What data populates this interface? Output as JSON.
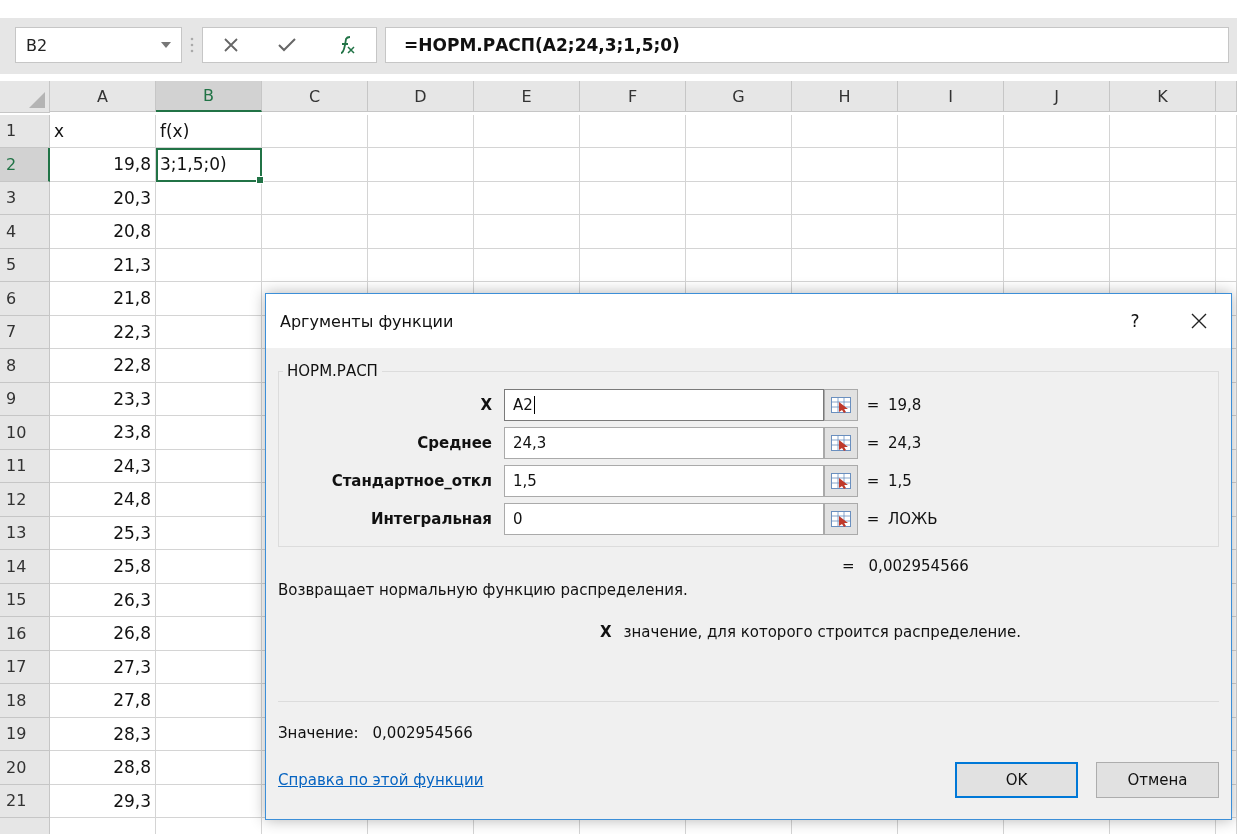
{
  "name_box": {
    "value": "B2"
  },
  "formula_bar": {
    "value": "=НОРМ.РАСП(A2;24,3;1,5;0)"
  },
  "columns": [
    {
      "label": "A",
      "selected": false
    },
    {
      "label": "B",
      "selected": true
    },
    {
      "label": "C",
      "selected": false
    },
    {
      "label": "D",
      "selected": false
    },
    {
      "label": "E",
      "selected": false
    },
    {
      "label": "F",
      "selected": false
    },
    {
      "label": "G",
      "selected": false
    },
    {
      "label": "H",
      "selected": false
    },
    {
      "label": "I",
      "selected": false
    },
    {
      "label": "J",
      "selected": false
    },
    {
      "label": "K",
      "selected": false
    }
  ],
  "rows": [
    {
      "label": "1",
      "selected": false,
      "cells": [
        {
          "text": "x",
          "kind": "text",
          "selected": false
        },
        {
          "text": "f(x)",
          "kind": "text",
          "selected": false
        }
      ]
    },
    {
      "label": "2",
      "selected": true,
      "cells": [
        {
          "text": "19,8",
          "kind": "number",
          "selected": false
        },
        {
          "text": "3;1,5;0)",
          "kind": "text",
          "selected": true
        }
      ]
    },
    {
      "label": "3",
      "selected": false,
      "cells": [
        {
          "text": "20,3",
          "kind": "number",
          "selected": false
        }
      ]
    },
    {
      "label": "4",
      "selected": false,
      "cells": [
        {
          "text": "20,8",
          "kind": "number",
          "selected": false
        }
      ]
    },
    {
      "label": "5",
      "selected": false,
      "cells": [
        {
          "text": "21,3",
          "kind": "number",
          "selected": false
        }
      ]
    },
    {
      "label": "6",
      "selected": false,
      "cells": [
        {
          "text": "21,8",
          "kind": "number",
          "selected": false
        }
      ]
    },
    {
      "label": "7",
      "selected": false,
      "cells": [
        {
          "text": "22,3",
          "kind": "number",
          "selected": false
        }
      ]
    },
    {
      "label": "8",
      "selected": false,
      "cells": [
        {
          "text": "22,8",
          "kind": "number",
          "selected": false
        }
      ]
    },
    {
      "label": "9",
      "selected": false,
      "cells": [
        {
          "text": "23,3",
          "kind": "number",
          "selected": false
        }
      ]
    },
    {
      "label": "10",
      "selected": false,
      "cells": [
        {
          "text": "23,8",
          "kind": "number",
          "selected": false
        }
      ]
    },
    {
      "label": "11",
      "selected": false,
      "cells": [
        {
          "text": "24,3",
          "kind": "number",
          "selected": false
        }
      ]
    },
    {
      "label": "12",
      "selected": false,
      "cells": [
        {
          "text": "24,8",
          "kind": "number",
          "selected": false
        }
      ]
    },
    {
      "label": "13",
      "selected": false,
      "cells": [
        {
          "text": "25,3",
          "kind": "number",
          "selected": false
        }
      ]
    },
    {
      "label": "14",
      "selected": false,
      "cells": [
        {
          "text": "25,8",
          "kind": "number",
          "selected": false
        }
      ]
    },
    {
      "label": "15",
      "selected": false,
      "cells": [
        {
          "text": "26,3",
          "kind": "number",
          "selected": false
        }
      ]
    },
    {
      "label": "16",
      "selected": false,
      "cells": [
        {
          "text": "26,8",
          "kind": "number",
          "selected": false
        }
      ]
    },
    {
      "label": "17",
      "selected": false,
      "cells": [
        {
          "text": "27,3",
          "kind": "number",
          "selected": false
        }
      ]
    },
    {
      "label": "18",
      "selected": false,
      "cells": [
        {
          "text": "27,8",
          "kind": "number",
          "selected": false
        }
      ]
    },
    {
      "label": "19",
      "selected": false,
      "cells": [
        {
          "text": "28,3",
          "kind": "number",
          "selected": false
        }
      ]
    },
    {
      "label": "20",
      "selected": false,
      "cells": [
        {
          "text": "28,8",
          "kind": "number",
          "selected": false
        }
      ]
    },
    {
      "label": "21",
      "selected": false,
      "cells": [
        {
          "text": "29,3",
          "kind": "number",
          "selected": false
        }
      ]
    }
  ],
  "dialog": {
    "title": "Аргументы функции",
    "help": "?",
    "group_title": "НОРМ.РАСП",
    "arguments": [
      {
        "label": "X",
        "value": "A2",
        "focused": true,
        "equals": "=",
        "result": "19,8"
      },
      {
        "label": "Среднее",
        "value": "24,3",
        "focused": false,
        "equals": "=",
        "result": "24,3"
      },
      {
        "label": "Стандартное_откл",
        "value": "1,5",
        "focused": false,
        "equals": "=",
        "result": "1,5"
      },
      {
        "label": "Интегральная",
        "value": "0",
        "focused": false,
        "equals": "=",
        "result": "ЛОЖЬ"
      }
    ],
    "total": {
      "equals": "=",
      "result": "0,002954566"
    },
    "description": "Возвращает нормальную функцию распределения.",
    "argument_help": {
      "name": "X",
      "text": "значение, для которого строится распределение."
    },
    "value_label": "Значение:",
    "value": "0,002954566",
    "help_link": "Справка по этой функции",
    "buttons": [
      {
        "label": "OK",
        "default": true
      },
      {
        "label": "Отмена",
        "default": false
      }
    ]
  }
}
